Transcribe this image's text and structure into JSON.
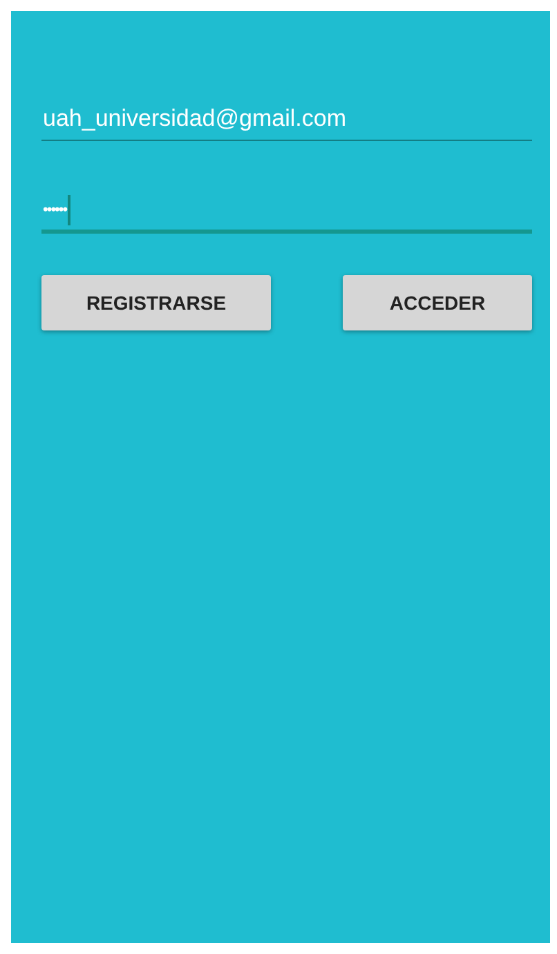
{
  "fields": [
    {
      "kind": "email",
      "value": "uah_universidad@gmail.com",
      "focused": false
    },
    {
      "kind": "password",
      "value": "••••••",
      "focused": true
    }
  ],
  "buttons": [
    {
      "label": "REGISTRARSE"
    },
    {
      "label": "ACCEDER"
    }
  ]
}
